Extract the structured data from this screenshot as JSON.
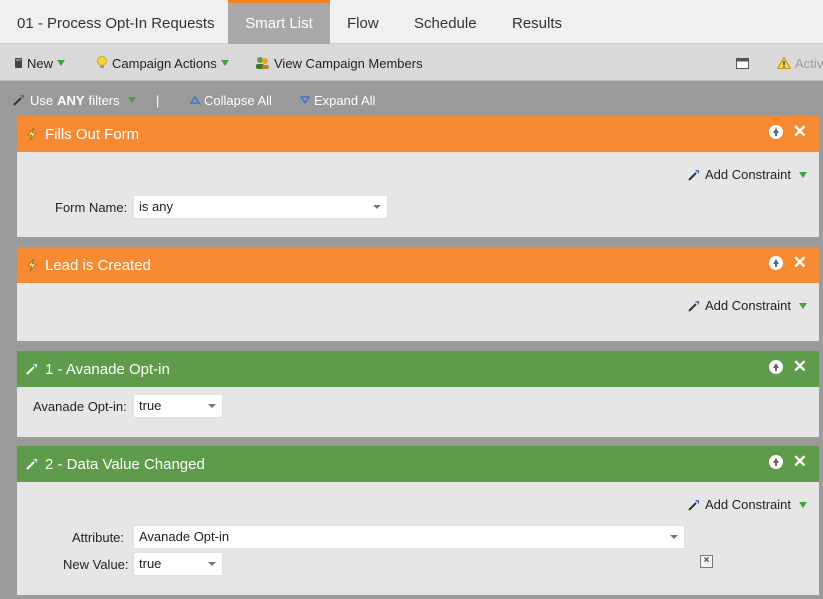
{
  "tabs": {
    "campaign_name": "01 - Process Opt-In Requests",
    "smart_list": "Smart List",
    "flow": "Flow",
    "schedule": "Schedule",
    "results": "Results"
  },
  "toolbar": {
    "new_label": "New",
    "campaign_actions_label": "Campaign Actions",
    "view_members_label": "View Campaign Members",
    "status_label": "Activ"
  },
  "filterbar": {
    "use_prefix": "Use",
    "use_any": "ANY",
    "use_suffix": "filters",
    "divider": "|",
    "collapse_all": "Collapse All",
    "expand_all": "Expand All"
  },
  "filters": [
    {
      "title": "Fills Out Form",
      "add_constraint": "Add Constraint",
      "fields": [
        {
          "label": "Form Name:",
          "value": "is any"
        }
      ]
    },
    {
      "title": "Lead is Created",
      "add_constraint": "Add Constraint"
    },
    {
      "title": "1 - Avanade Opt-in",
      "fields": [
        {
          "label": "Avanade Opt-in:",
          "value": "true"
        }
      ]
    },
    {
      "title": "2 - Data Value Changed",
      "add_constraint": "Add Constraint",
      "fields": [
        {
          "label": "Attribute:",
          "value": "Avanade Opt-in"
        },
        {
          "label": "New Value:",
          "value": "true"
        }
      ]
    }
  ],
  "colors": {
    "trigger_header": "#f58a32",
    "filter_header": "#5e9b4a",
    "active_tab_accent": "#f58220"
  }
}
